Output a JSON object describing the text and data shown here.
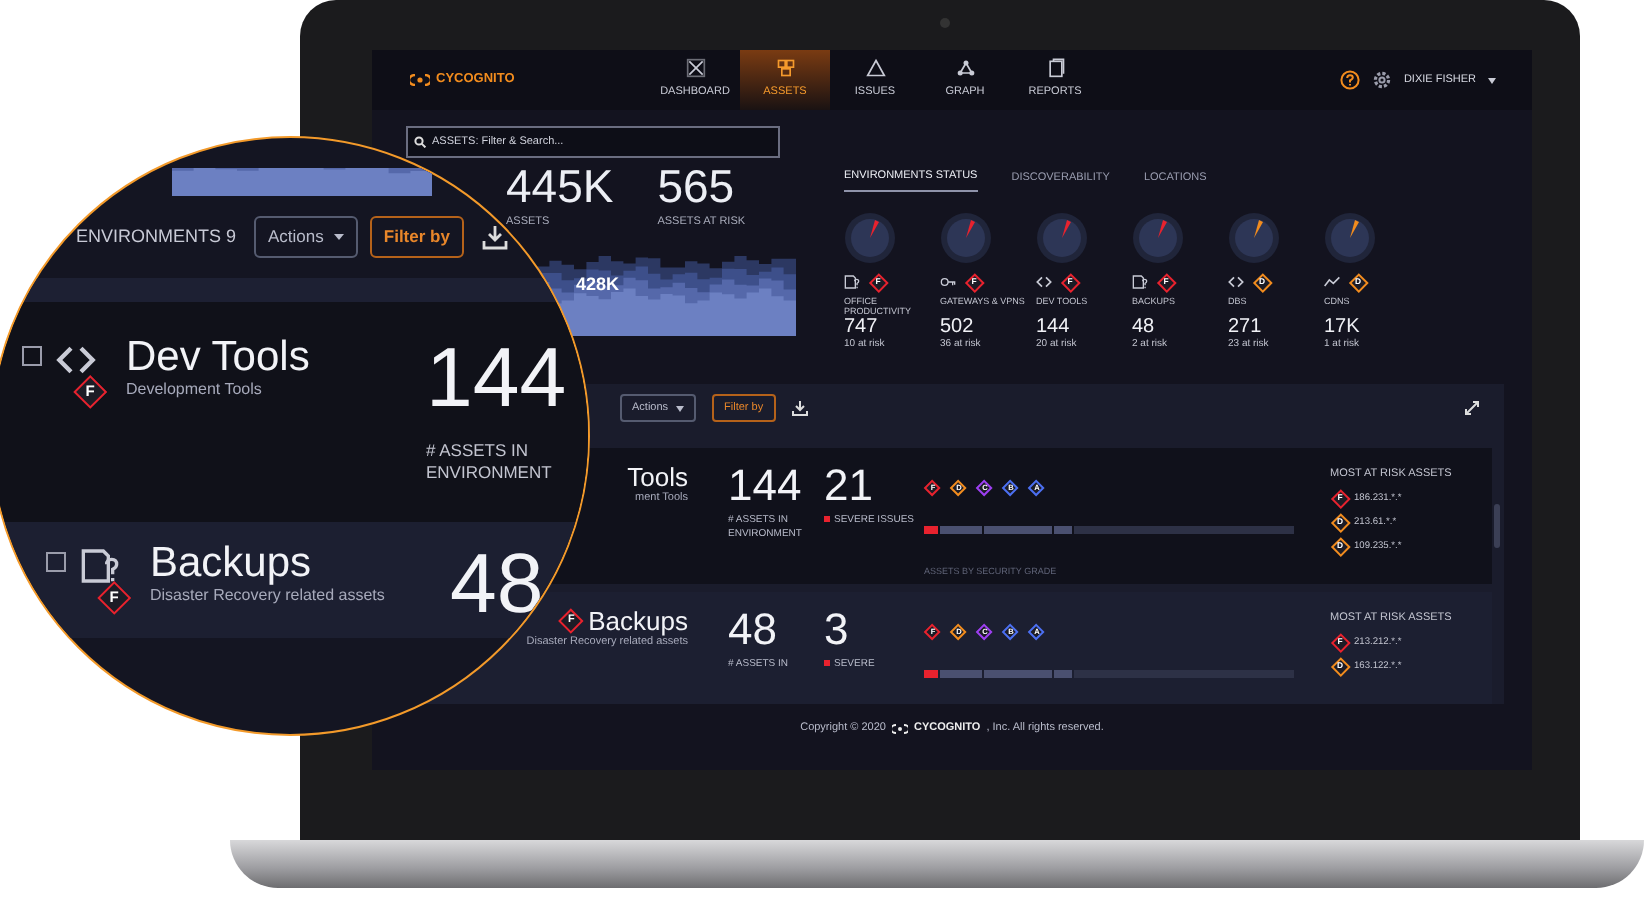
{
  "header": {
    "logo": "CYCOGNITO",
    "user": "DIXIE FISHER"
  },
  "nav": [
    {
      "kind": "dashboard",
      "label": "DASHBOARD",
      "selected": false
    },
    {
      "kind": "assets",
      "label": "ASSETS",
      "selected": true
    },
    {
      "kind": "issues",
      "label": "ISSUES",
      "selected": false
    },
    {
      "kind": "graph",
      "label": "GRAPH",
      "selected": false
    },
    {
      "kind": "reports",
      "label": "REPORTS",
      "selected": false
    }
  ],
  "search": {
    "placeholder": "ASSETS: Filter & Search..."
  },
  "stats": [
    {
      "value": "445K",
      "label": "ASSETS"
    },
    {
      "value": "565",
      "label": "ASSETS AT RISK"
    }
  ],
  "chart_label": "428K",
  "status_tabs": [
    {
      "label": "ENVIRONMENTS STATUS",
      "selected": true
    },
    {
      "label": "DISCOVERABILITY",
      "selected": false
    },
    {
      "label": "LOCATIONS",
      "selected": false
    }
  ],
  "environments_status": [
    {
      "kind": "office",
      "grade": "F",
      "label": "OFFICE PRODUCTIVITY",
      "value": "747",
      "at_risk": "10 at risk"
    },
    {
      "kind": "gateway",
      "grade": "F",
      "label": "GATEWAYS & VPNS",
      "value": "502",
      "at_risk": "36 at risk"
    },
    {
      "kind": "code",
      "grade": "F",
      "label": "DEV TOOLS",
      "value": "144",
      "at_risk": "20 at risk"
    },
    {
      "kind": "office",
      "grade": "F",
      "label": "BACKUPS",
      "value": "48",
      "at_risk": "2 at risk"
    },
    {
      "kind": "code",
      "grade": "D",
      "label": "DBS",
      "value": "271",
      "at_risk": "23 at risk"
    },
    {
      "kind": "trend",
      "grade": "D",
      "label": "CDNS",
      "value": "17K",
      "at_risk": "1 at risk"
    }
  ],
  "toolbar": {
    "actions": "Actions",
    "filter": "Filter by"
  },
  "environments": [
    {
      "name": "Tools",
      "description": "ment Tools",
      "count": "144",
      "count_label": "# ASSETS IN ENVIRONMENT",
      "issues": "21",
      "issues_label": "SEVERE ISSUES",
      "grades": [
        "F",
        "D",
        "C",
        "B",
        "A"
      ],
      "grade_caption": "ASSETS BY SECURITY GRADE",
      "risk_title": "MOST AT RISK ASSETS",
      "risk_assets": [
        {
          "grade": "F",
          "ip": "186.231.*.*"
        },
        {
          "grade": "D",
          "ip": "213.61.*.*"
        },
        {
          "grade": "D",
          "ip": "109.235.*.*"
        }
      ]
    },
    {
      "grade": "F",
      "name": "Backups",
      "description": "Disaster Recovery related assets",
      "count": "48",
      "count_label": "# ASSETS IN",
      "issues": "3",
      "issues_label": "SEVERE",
      "grades": [
        "F",
        "D",
        "C",
        "B",
        "A"
      ],
      "risk_title": "MOST AT RISK ASSETS",
      "risk_assets": [
        {
          "grade": "F",
          "ip": "213.212.*.*"
        },
        {
          "grade": "D",
          "ip": "163.122.*.*"
        }
      ]
    }
  ],
  "footer": {
    "before": "Copyright © 2020",
    "brand": "CYCOGNITO",
    "after": ", Inc. All rights reserved."
  },
  "magnifier": {
    "title": "ENVIRONMENTS 9",
    "actions": "Actions",
    "filter": "Filter by",
    "rows": [
      {
        "checked": false,
        "kind": "code",
        "grade": "F",
        "name": "Dev Tools",
        "description": "Development Tools",
        "count": "144",
        "count_label": "# ASSETS IN ENVIRONMENT"
      },
      {
        "checked": false,
        "kind": "office",
        "grade": "F",
        "name": "Backups",
        "description": "Disaster Recovery related assets",
        "count": "48"
      }
    ]
  }
}
